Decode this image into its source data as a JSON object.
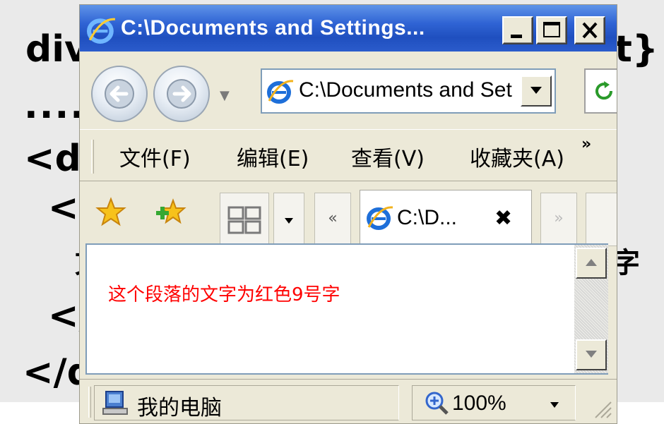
{
  "background_slide": {
    "line1_left": "div",
    "line1_right": "t}",
    "line2": "....",
    "line3": "<d",
    "line4": "<",
    "line5_left": "文",
    "line5_right": "字",
    "line6": "</",
    "line7": "</d"
  },
  "window": {
    "title": "C:\\Documents and Settings...",
    "controls": {
      "minimize": "minimize",
      "maximize": "maximize",
      "close": "close"
    }
  },
  "navigation": {
    "address": "C:\\Documents and Set"
  },
  "menu": {
    "items": [
      "文件(F)",
      "编辑(E)",
      "查看(V)",
      "收藏夹(A)"
    ],
    "overflow": "»"
  },
  "tabs": {
    "scroll_left": "«",
    "scroll_right": "»",
    "active_title": "C:\\D...",
    "close_glyph": "✖"
  },
  "content": {
    "paragraph": "这个段落的文字为红色9号字",
    "paragraph_color": "#ff0000"
  },
  "status_bar": {
    "zone": "我的电脑",
    "zoom": "100%"
  },
  "colors": {
    "titlebar": "#2f63d4",
    "chrome": "#ece9d8",
    "address_border": "#7f9db9"
  },
  "icons": [
    "ie-icon",
    "back-icon",
    "forward-icon",
    "refresh-icon",
    "favorites-star-icon",
    "add-favorites-icon",
    "quick-tabs-icon",
    "computer-icon",
    "zoom-icon"
  ]
}
